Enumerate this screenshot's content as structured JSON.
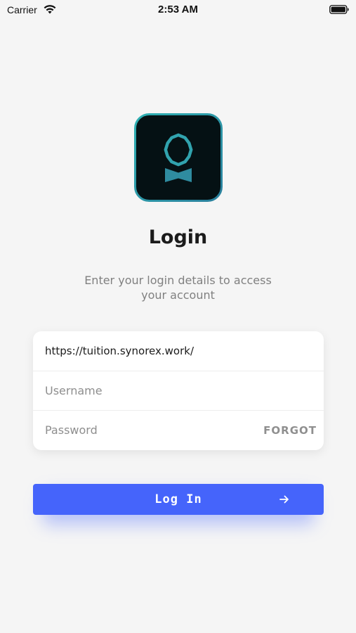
{
  "status_bar": {
    "carrier": "Carrier",
    "time": "2:53 AM",
    "wifi_icon": "wifi-icon",
    "battery_icon": "battery-full-icon"
  },
  "logo": {
    "icon": "award-badge-icon",
    "colors": {
      "background": "#051114",
      "border": "#2ea3ad",
      "accent": "#31a3ae"
    }
  },
  "title": "Login",
  "subtitle": "Enter your login details to access your account",
  "form": {
    "url_value": "https://tuition.synorex.work/",
    "username_placeholder": "Username",
    "username_value": "",
    "password_placeholder": "Password",
    "password_value": "",
    "forgot_label": "FORGOT"
  },
  "login_button": {
    "label": "Log In",
    "icon": "arrow-right-icon",
    "color": "#4564fb"
  }
}
